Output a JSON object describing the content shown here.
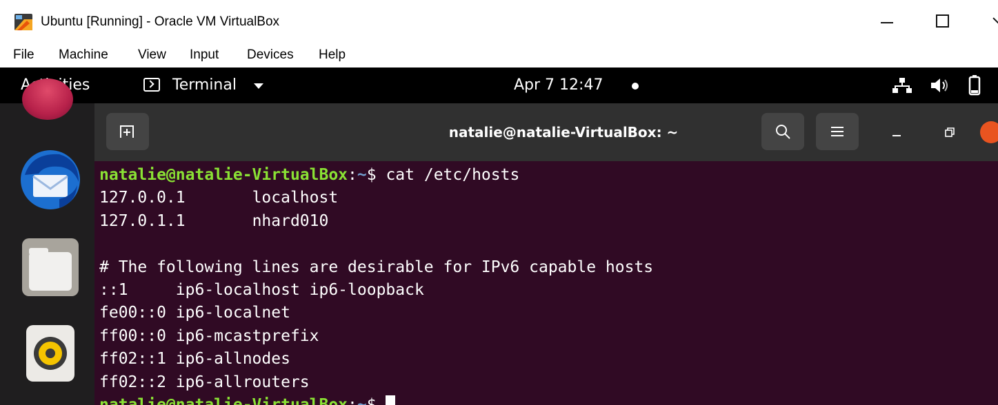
{
  "window": {
    "title": "Ubuntu [Running] - Oracle VM VirtualBox",
    "icon": "virtualbox-icon",
    "controls": [
      "minimize-icon",
      "maximize-icon",
      "close-icon"
    ]
  },
  "menu": {
    "items": [
      "File",
      "Machine",
      "View",
      "Input",
      "Devices",
      "Help"
    ]
  },
  "topbar": {
    "activities": "Activities",
    "app_name": "Terminal",
    "app_icon": "terminal-icon",
    "clock": "Apr 7  12:47",
    "status_icons": [
      "network-icon",
      "volume-icon",
      "battery-icon"
    ]
  },
  "dock": {
    "items": [
      "ubuntu-software-icon",
      "thunderbird-icon",
      "files-icon",
      "rhythmbox-icon"
    ]
  },
  "terminal": {
    "header_title": "natalie@natalie-VirtualBox: ~",
    "buttons": [
      "new-tab-icon",
      "search-icon",
      "hamburger-menu-icon",
      "minimize-icon",
      "restore-icon",
      "close-icon"
    ],
    "prompt_user": "natalie@natalie-VirtualBox",
    "prompt_sep": ":",
    "prompt_path": "~",
    "prompt_sym": "$ ",
    "command": "cat /etc/hosts",
    "output": [
      "127.0.0.1\tlocalhost",
      "127.0.1.1\tnhard010",
      "",
      "# The following lines are desirable for IPv6 capable hosts",
      "::1     ip6-localhost ip6-loopback",
      "fe00::0 ip6-localnet",
      "ff00::0 ip6-mcastprefix",
      "ff02::1 ip6-allnodes",
      "ff02::2 ip6-allrouters"
    ]
  }
}
